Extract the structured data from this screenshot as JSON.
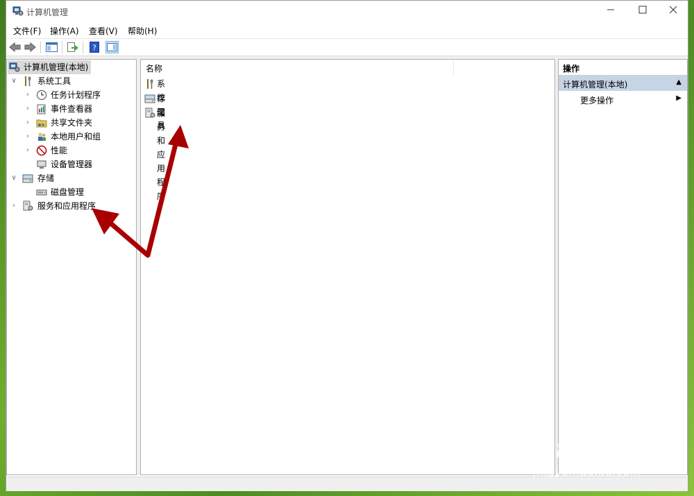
{
  "window": {
    "title": "计算机管理"
  },
  "menu": [
    "文件(F)",
    "操作(A)",
    "查看(V)",
    "帮助(H)"
  ],
  "toolbar": {
    "buttons": [
      "back-icon",
      "forward-icon",
      "show-hide-console-tree-icon",
      "export-list-icon",
      "help-icon",
      "show-hide-action-pane-icon"
    ]
  },
  "tree": {
    "root": "计算机管理(本地)",
    "system_tools": "系统工具",
    "task_scheduler": "任务计划程序",
    "event_viewer": "事件查看器",
    "shared_folders": "共享文件夹",
    "local_users": "本地用户和组",
    "performance": "性能",
    "device_manager": "设备管理器",
    "storage": "存储",
    "disk_management": "磁盘管理",
    "services_apps": "服务和应用程序"
  },
  "center": {
    "column_name": "名称",
    "items": [
      "系统工具",
      "存储",
      "服务和应用程序"
    ]
  },
  "actions": {
    "header": "操作",
    "section": "计算机管理(本地)",
    "more": "更多操作"
  },
  "watermark": {
    "text": "jingyan.baidu.com"
  },
  "colors": {
    "annotation_arrow": "#b00000",
    "selection": "#d9d9d9",
    "action_section": "#c6d4e6"
  }
}
